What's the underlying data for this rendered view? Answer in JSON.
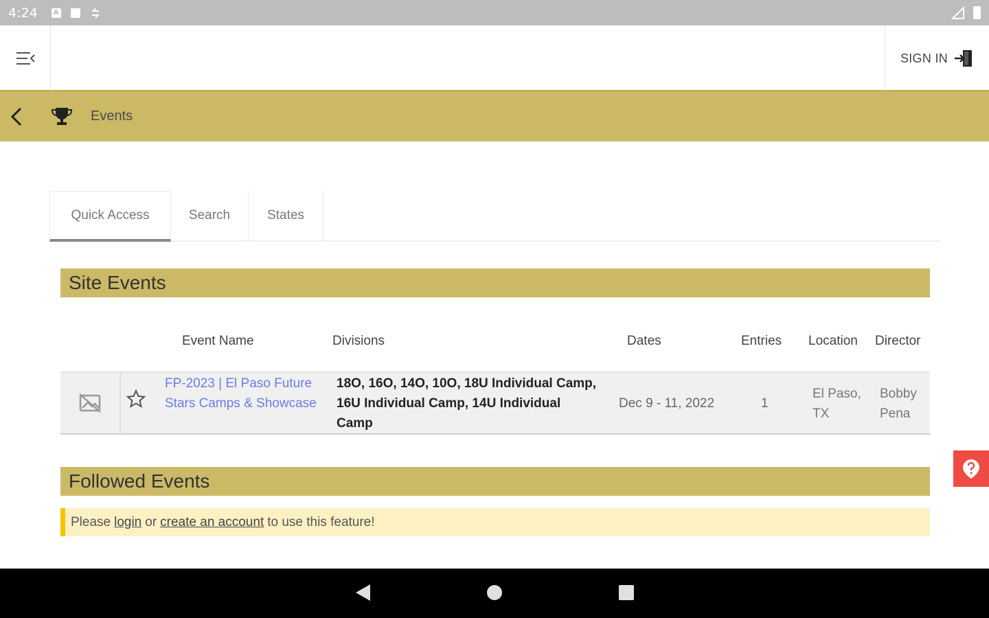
{
  "statusbar": {
    "time": "4:24"
  },
  "header": {
    "sign_in_label": "SIGN IN"
  },
  "eventsbar": {
    "title": "Events"
  },
  "tabs": [
    {
      "label": "Quick Access"
    },
    {
      "label": "Search"
    },
    {
      "label": "States"
    }
  ],
  "site_events": {
    "title": "Site Events",
    "columns": {
      "event_name": "Event Name",
      "divisions": "Divisions",
      "dates": "Dates",
      "entries": "Entries",
      "location": "Location",
      "director": "Director"
    },
    "rows": [
      {
        "event_name": "FP-2023 | El Paso Future Stars Camps & Showcase",
        "divisions": "18O, 16O, 14O, 10O, 18U Individual Camp, 16U Individual Camp, 14U Individual Camp",
        "dates": "Dec 9 - 11, 2022",
        "entries": "1",
        "location": "El Paso, TX",
        "director": "Bobby Pena"
      }
    ]
  },
  "followed_events": {
    "title": "Followed Events",
    "notice_prefix": "Please",
    "login_link": "login",
    "notice_or": "or",
    "create_account_link": "create an account",
    "notice_suffix": "to use this feature!"
  },
  "colors": {
    "gold": "#cbb966",
    "link": "#6b7de6",
    "notice_bg": "#fdf1c4",
    "notice_border": "#f5c300",
    "help": "#ee4b42"
  }
}
